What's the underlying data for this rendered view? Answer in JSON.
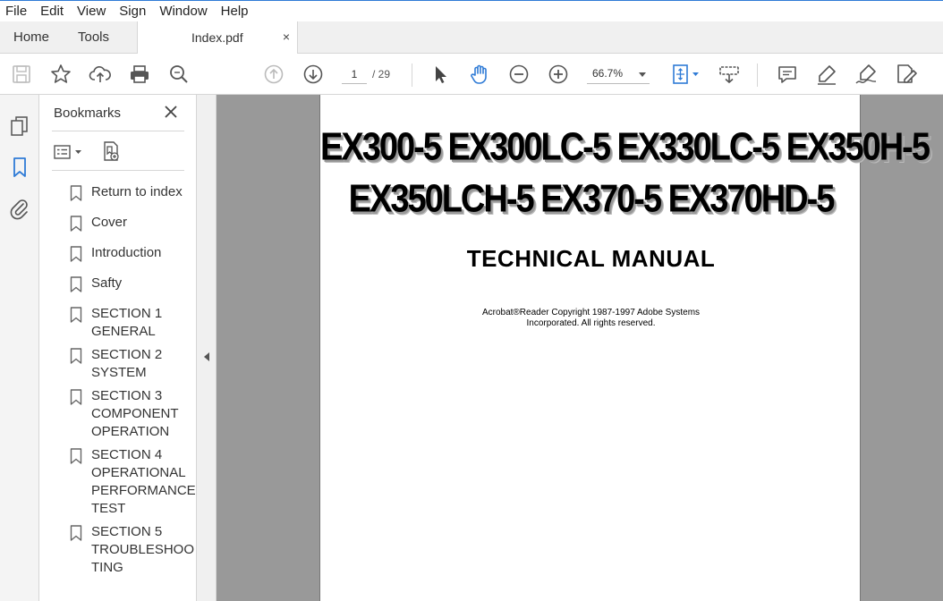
{
  "menu": [
    "File",
    "Edit",
    "View",
    "Sign",
    "Window",
    "Help"
  ],
  "tabs": {
    "home": "Home",
    "tools": "Tools",
    "document": "Index.pdf",
    "close_glyph": "×"
  },
  "toolbar": {
    "page_current": "1",
    "page_total": "/ 29",
    "zoom": "66.7%",
    "icons": [
      "save-icon",
      "star-icon",
      "upload-icon",
      "print-icon",
      "zoom-search-icon",
      "page-up-icon",
      "page-down-icon",
      "select-arrow-icon",
      "hand-icon",
      "zoom-out-icon",
      "zoom-in-icon",
      "fit-page-icon",
      "scroll-mode-icon",
      "comment-icon",
      "highlight-icon",
      "sign-icon",
      "fill-sign-icon"
    ]
  },
  "bookmarks_panel": {
    "title": "Bookmarks",
    "items": [
      {
        "label": "Return to index"
      },
      {
        "label": "Cover"
      },
      {
        "label": "Introduction"
      },
      {
        "label": "Safty"
      },
      {
        "label": "SECTION 1 GENERAL"
      },
      {
        "label": "SECTION 2 SYSTEM"
      },
      {
        "label": "SECTION 3 COMPONENT OPERATION"
      },
      {
        "label": "SECTION 4 OPERATIONAL PERFORMANCE TEST"
      },
      {
        "label": "SECTION 5 TROUBLESHOO TING"
      }
    ]
  },
  "document": {
    "models_line1": "EX300-5  EX300LC-5  EX330LC-5  EX350H-5",
    "models_line2": "EX350LCH-5  EX370-5  EX370HD-5",
    "title": "TECHNICAL MANUAL",
    "copyright_line1": "Acrobat®Reader Copyright 1987-1997 Adobe Systems",
    "copyright_line2": "Incorporated. All rights reserved."
  },
  "colors": {
    "accent": "#2f7bd6",
    "doc_background": "#999999",
    "panel_background": "#f4f4f4"
  }
}
